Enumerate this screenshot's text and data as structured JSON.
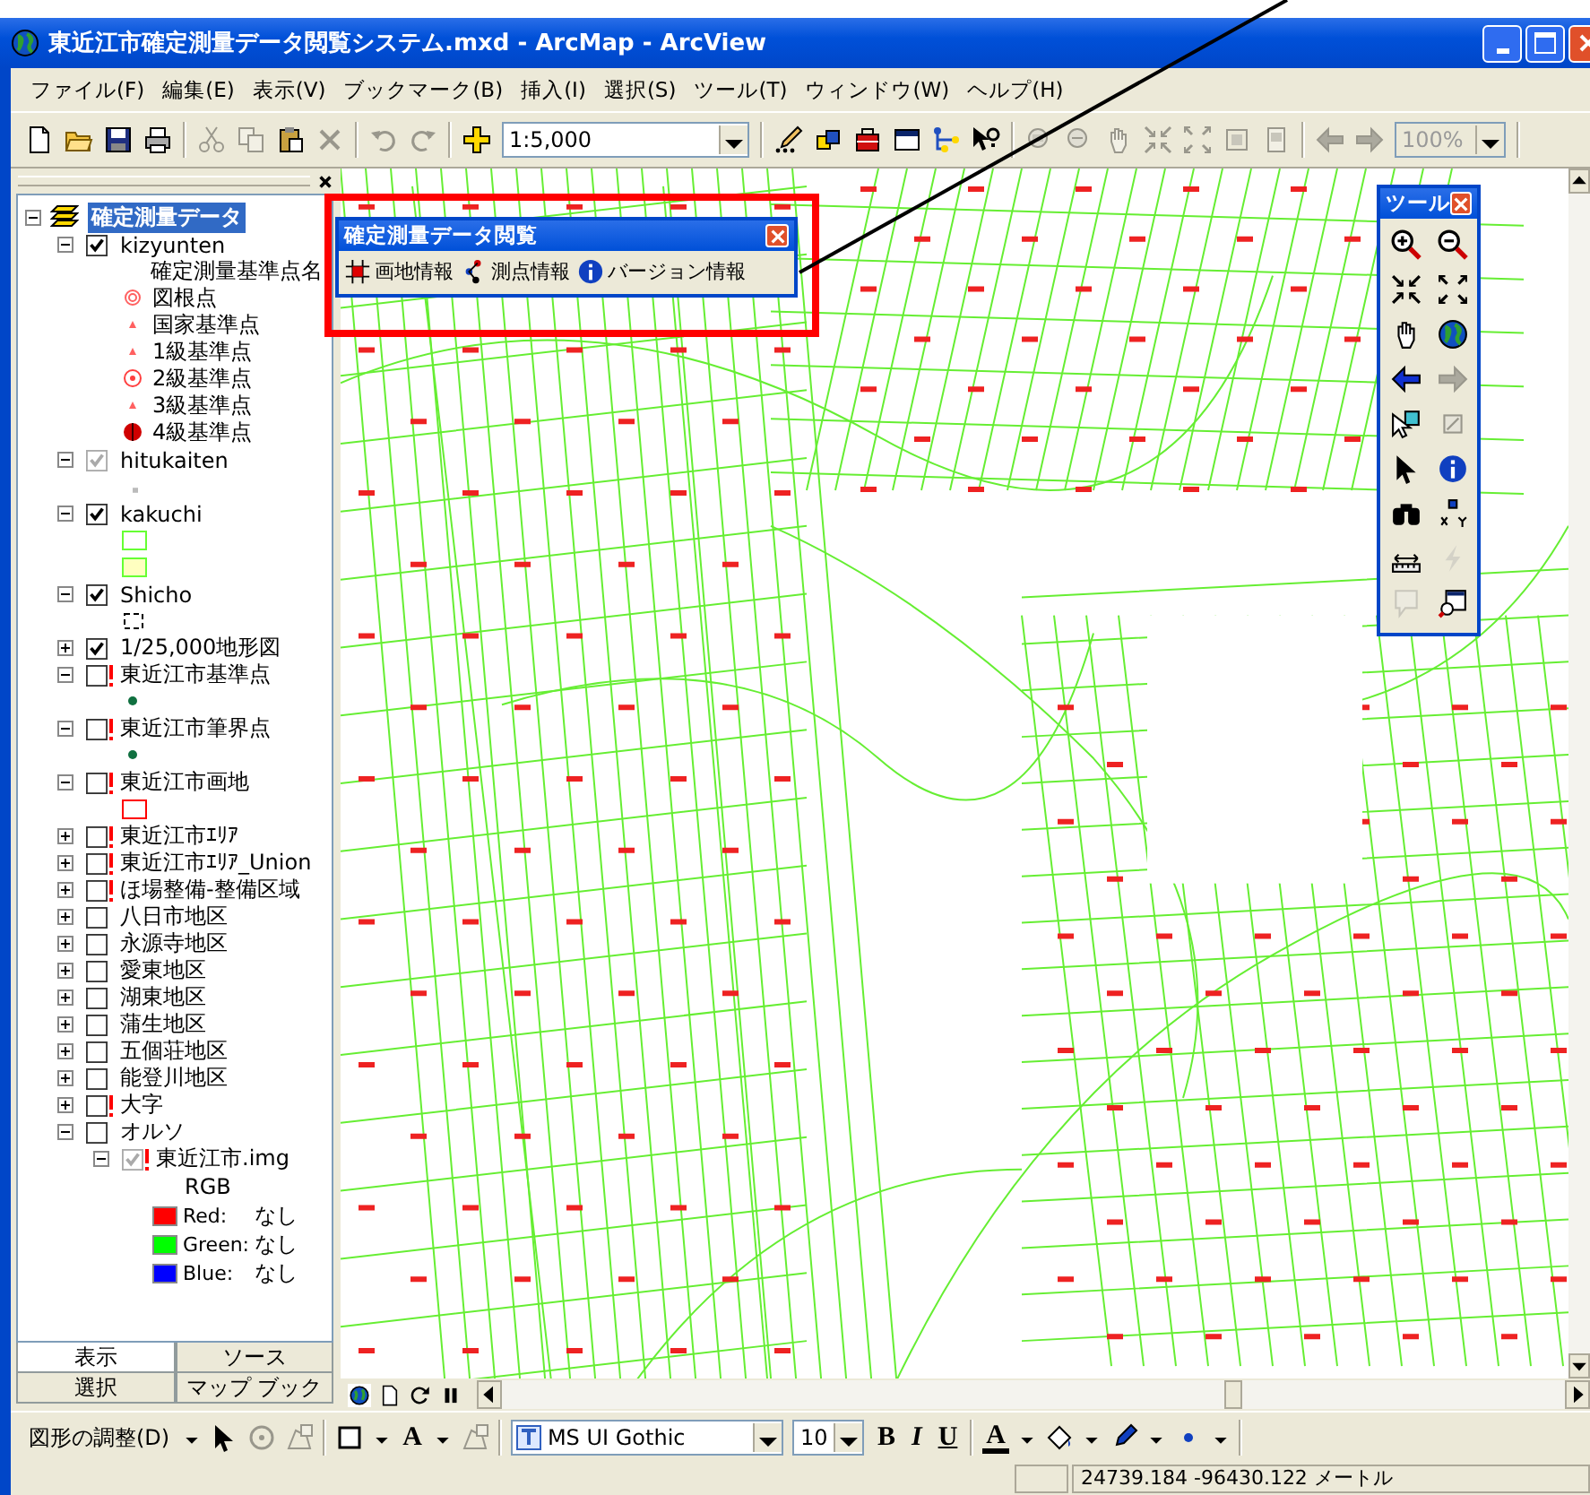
{
  "window": {
    "title": "東近江市確定測量データ閲覧システム.mxd - ArcMap - ArcView"
  },
  "menu": [
    "ファイル(F)",
    "編集(E)",
    "表示(V)",
    "ブックマーク(B)",
    "挿入(I)",
    "選択(S)",
    "ツール(T)",
    "ウィンドウ(W)",
    "ヘルプ(H)"
  ],
  "toolbar": {
    "left": [
      {
        "kind": "new",
        "disabled": false
      },
      {
        "kind": "open",
        "disabled": false
      },
      {
        "kind": "save",
        "disabled": false
      },
      {
        "kind": "print",
        "disabled": false
      },
      {
        "kind": "cut",
        "disabled": true
      },
      {
        "kind": "copy",
        "disabled": true
      },
      {
        "kind": "paste",
        "disabled": false
      },
      {
        "kind": "delete",
        "disabled": true
      },
      {
        "kind": "undo",
        "disabled": true
      },
      {
        "kind": "redo",
        "disabled": true
      },
      {
        "kind": "adddata",
        "disabled": false
      }
    ],
    "scale": "1:5,000",
    "right": [
      {
        "kind": "editor",
        "disabled": false
      },
      {
        "kind": "toolbox",
        "disabled": false
      },
      {
        "kind": "redbox",
        "disabled": false
      },
      {
        "kind": "window",
        "disabled": false
      },
      {
        "kind": "graph",
        "disabled": false
      },
      {
        "kind": "help",
        "disabled": false
      },
      {
        "kind": "zoomlayer",
        "disabled": true
      },
      {
        "kind": "zoomsel",
        "disabled": true
      },
      {
        "kind": "pan",
        "disabled": true
      },
      {
        "kind": "shrink",
        "disabled": true
      },
      {
        "kind": "expand",
        "disabled": true
      },
      {
        "kind": "full",
        "disabled": true
      },
      {
        "kind": "page",
        "disabled": true
      },
      {
        "kind": "back",
        "disabled": true
      },
      {
        "kind": "forward",
        "disabled": true
      }
    ],
    "zoom": {
      "value": "100%",
      "disabled": true
    }
  },
  "toc": {
    "root": {
      "label": "確定測量データ",
      "selected": true,
      "expanded": true
    },
    "layers": [
      {
        "label": "kizyunten",
        "expanded": true,
        "checked": true,
        "dimmed": false,
        "warning": false,
        "legend": [
          {
            "kind": "heading",
            "label": "確定測量基準点名"
          },
          {
            "kind": "ring",
            "label": "図根点"
          },
          {
            "kind": "point",
            "label": "国家基準点"
          },
          {
            "kind": "point",
            "label": "1級基準点"
          },
          {
            "kind": "target",
            "label": "2級基準点"
          },
          {
            "kind": "point",
            "label": "3級基準点"
          },
          {
            "kind": "disc",
            "label": "4級基準点"
          }
        ]
      },
      {
        "label": "hitukaiten",
        "expanded": true,
        "checked": true,
        "dimmed": true,
        "warning": false,
        "legend": [
          {
            "kind": "speck"
          }
        ]
      },
      {
        "label": "kakuchi",
        "expanded": true,
        "checked": true,
        "dimmed": false,
        "warning": false,
        "legend": [
          {
            "kind": "box",
            "color": "#66ff33"
          },
          {
            "kind": "filledbox",
            "color": "#66ff33"
          }
        ]
      },
      {
        "label": "Shicho",
        "expanded": true,
        "checked": true,
        "dimmed": false,
        "warning": false,
        "legend": [
          {
            "kind": "dash"
          }
        ]
      },
      {
        "label": "1/25,000地形図",
        "expanded": false,
        "checked": true,
        "dimmed": false,
        "warning": false
      },
      {
        "label": "東近江市基準点",
        "expanded": true,
        "checked": false,
        "dimmed": false,
        "warning": true,
        "legend": [
          {
            "kind": "dot"
          }
        ]
      },
      {
        "label": "東近江市筆界点",
        "expanded": true,
        "checked": false,
        "dimmed": false,
        "warning": true,
        "legend": [
          {
            "kind": "dot"
          }
        ]
      },
      {
        "label": "東近江市画地",
        "expanded": true,
        "checked": false,
        "dimmed": false,
        "warning": true,
        "legend": [
          {
            "kind": "box",
            "color": "#ff0000"
          }
        ]
      },
      {
        "label": "東近江市ｴﾘｱ",
        "expanded": false,
        "checked": false,
        "dimmed": false,
        "warning": true
      },
      {
        "label": "東近江市ｴﾘｱ_Union",
        "expanded": false,
        "checked": false,
        "dimmed": false,
        "warning": true
      },
      {
        "label": "ほ場整備-整備区域",
        "expanded": false,
        "checked": false,
        "dimmed": false,
        "warning": true
      },
      {
        "label": "八日市地区",
        "expanded": false,
        "checked": false,
        "dimmed": false,
        "warning": false
      },
      {
        "label": "永源寺地区",
        "expanded": false,
        "checked": false,
        "dimmed": false,
        "warning": false
      },
      {
        "label": "愛東地区",
        "expanded": false,
        "checked": false,
        "dimmed": false,
        "warning": false
      },
      {
        "label": "湖東地区",
        "expanded": false,
        "checked": false,
        "dimmed": false,
        "warning": false
      },
      {
        "label": "蒲生地区",
        "expanded": false,
        "checked": false,
        "dimmed": false,
        "warning": false
      },
      {
        "label": "五個荘地区",
        "expanded": false,
        "checked": false,
        "dimmed": false,
        "warning": false
      },
      {
        "label": "能登川地区",
        "expanded": false,
        "checked": false,
        "dimmed": false,
        "warning": false
      },
      {
        "label": "大字",
        "expanded": false,
        "checked": false,
        "dimmed": false,
        "warning": true
      },
      {
        "label": "オルソ",
        "expanded": true,
        "checked": false,
        "dimmed": false,
        "warning": false,
        "children": [
          {
            "label": "東近江市.img",
            "expanded": true,
            "checked": true,
            "dimmed": true,
            "warning": true,
            "legend": [
              {
                "kind": "heading",
                "label": "RGB"
              },
              {
                "kind": "swatch",
                "color": "#ff0000",
                "label": "Red:",
                "value": "なし"
              },
              {
                "kind": "swatch",
                "color": "#00ff00",
                "label": "Green:",
                "value": "なし"
              },
              {
                "kind": "swatch",
                "color": "#0000ff",
                "label": "Blue:",
                "value": "なし"
              }
            ]
          }
        ]
      }
    ],
    "tabs": [
      {
        "label": "表示",
        "selected": true
      },
      {
        "label": "ソース",
        "selected": false
      },
      {
        "label": "選択",
        "selected": false
      },
      {
        "label": "マップ ブック",
        "selected": false
      }
    ]
  },
  "dialog": {
    "title": "確定測量データ閲覧",
    "buttons": [
      {
        "kind": "parcel",
        "label": "画地情報"
      },
      {
        "kind": "survey",
        "label": "測点情報"
      },
      {
        "kind": "info",
        "label": "バージョン情報"
      }
    ]
  },
  "palette": {
    "title": "ツール",
    "tools": [
      {
        "kind": "zoomin",
        "disabled": false
      },
      {
        "kind": "zoomout",
        "disabled": false
      },
      {
        "kind": "shrink",
        "disabled": false
      },
      {
        "kind": "expand",
        "disabled": false
      },
      {
        "kind": "hand",
        "disabled": false
      },
      {
        "kind": "globe",
        "disabled": false
      },
      {
        "kind": "back",
        "disabled": false
      },
      {
        "kind": "forward",
        "disabled": true
      },
      {
        "kind": "selectbox",
        "disabled": false
      },
      {
        "kind": "clearbox",
        "disabled": true
      },
      {
        "kind": "pointer",
        "disabled": false
      },
      {
        "kind": "info",
        "disabled": false
      },
      {
        "kind": "find",
        "disabled": false
      },
      {
        "kind": "xy",
        "disabled": false
      },
      {
        "kind": "measure",
        "disabled": false
      },
      {
        "kind": "hyperlink",
        "disabled": true
      },
      {
        "kind": "note",
        "disabled": true
      },
      {
        "kind": "viewer",
        "disabled": false
      }
    ]
  },
  "map_bar": [
    {
      "kind": "dataview",
      "selected": true
    },
    {
      "kind": "layoutview",
      "selected": false
    },
    {
      "kind": "refresh",
      "selected": false
    },
    {
      "kind": "pause",
      "selected": false
    }
  ],
  "drawing": {
    "menu": "図形の調整(D)",
    "text_tool": "A",
    "font": "MS UI Gothic",
    "size": "10",
    "styles": [
      "B",
      "I",
      "U"
    ],
    "font_color": "A"
  },
  "status": {
    "coordinates": "24739.184  -96430.122 メートル"
  }
}
